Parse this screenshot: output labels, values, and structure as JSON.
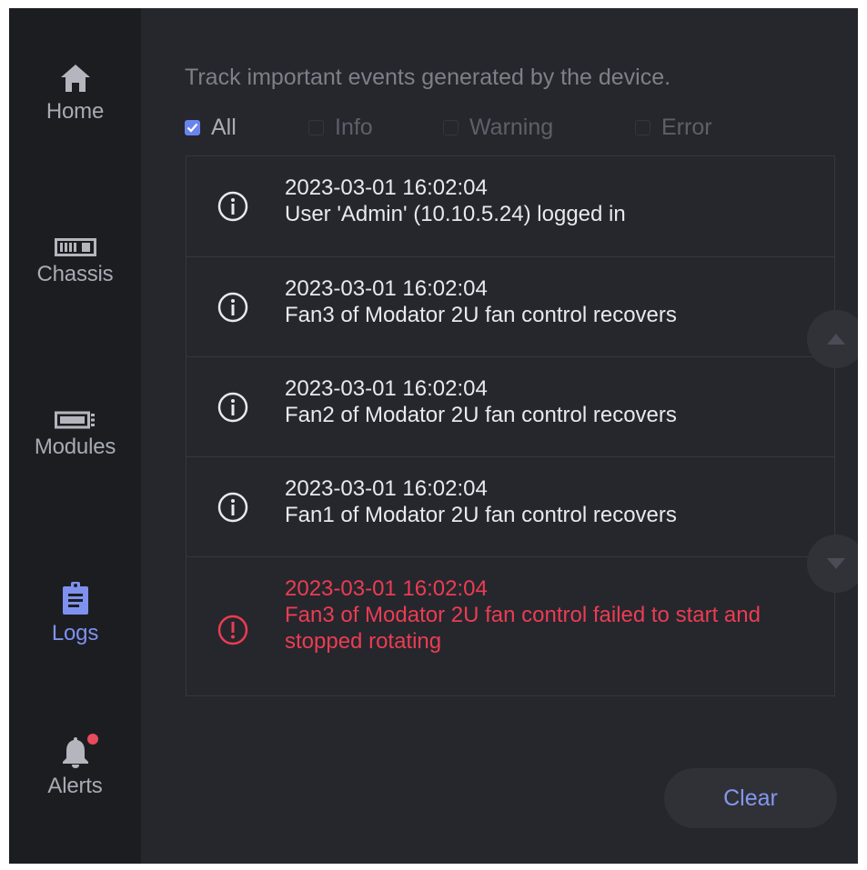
{
  "sidebar": {
    "items": [
      {
        "label": "Home",
        "icon": "home-icon"
      },
      {
        "label": "Chassis",
        "icon": "chassis-icon"
      },
      {
        "label": "Modules",
        "icon": "modules-icon"
      },
      {
        "label": "Logs",
        "icon": "clipboard-icon",
        "active": true
      },
      {
        "label": "Alerts",
        "icon": "bell-icon",
        "has_notification": true
      }
    ]
  },
  "header": {
    "description": "Track important events generated by the device."
  },
  "filters": [
    {
      "label": "All",
      "checked": true
    },
    {
      "label": "Info",
      "checked": false
    },
    {
      "label": "Warning",
      "checked": false
    },
    {
      "label": "Error",
      "checked": false
    }
  ],
  "logs": [
    {
      "level": "info",
      "timestamp": "2023-03-01 16:02:04",
      "message": "User 'Admin' (10.10.5.24) logged in"
    },
    {
      "level": "info",
      "timestamp": "2023-03-01 16:02:04",
      "message": "Fan3 of Modator 2U fan control recovers"
    },
    {
      "level": "info",
      "timestamp": "2023-03-01 16:02:04",
      "message": "Fan2 of Modator 2U fan control recovers"
    },
    {
      "level": "info",
      "timestamp": "2023-03-01 16:02:04",
      "message": "Fan1 of Modator 2U fan control recovers"
    },
    {
      "level": "error",
      "timestamp": "2023-03-01 16:02:04",
      "message": "Fan3 of Modator 2U fan control failed to start and stopped rotating"
    }
  ],
  "actions": {
    "clear_label": "Clear"
  },
  "colors": {
    "accent": "#7e91ee",
    "error": "#ec3c52",
    "background": "#25272d",
    "sidebar": "#1c1d21",
    "notification": "#e84b5c"
  }
}
